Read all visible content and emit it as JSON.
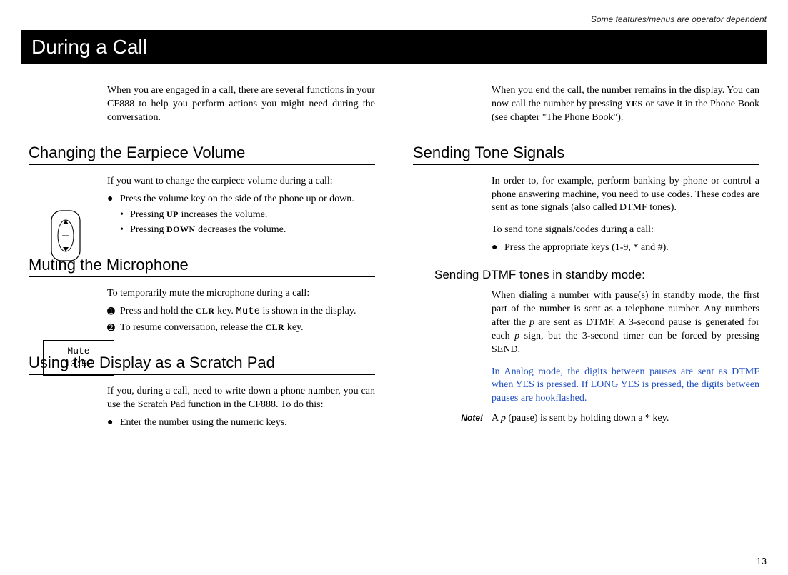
{
  "header_note": "Some features/menus are operator dependent",
  "page_title": "During a Call",
  "page_number": "13",
  "left": {
    "intro": "When you are engaged in a call, there are several functions in your CF888 to help you perform actions you might need during the conversation.",
    "s1": {
      "heading": "Changing the Earpiece Volume",
      "lead": "If you want to change the earpiece volume during a call:",
      "b1_pre": "Press the volume key on the side of the phone up or down.",
      "sb1_pre": "Pressing ",
      "sb1_key": "UP",
      "sb1_post": " increases the volume.",
      "sb2_pre": "Pressing ",
      "sb2_key": "DOWN",
      "sb2_post": " decreases the volume."
    },
    "s2": {
      "heading": "Muting the Microphone",
      "lead": "To temporarily mute the microphone during a call:",
      "b1_pre": "Press and hold the ",
      "b1_key": "CLR",
      "b1_mid": " key. ",
      "b1_mono": "Mute",
      "b1_post": " is shown in the display.",
      "b2_pre": "To resume conversation, release the ",
      "b2_key": "CLR",
      "b2_post": " key.",
      "display_line1": "Mute",
      "display_line2": "13:52"
    },
    "s3": {
      "heading": "Using the Display as a Scratch Pad",
      "lead": "If you, during a call, need to write down a phone number, you can use the Scratch Pad function in the CF888. To do this:",
      "b1": "Enter the number using the numeric keys."
    }
  },
  "right": {
    "intro_pre": "When you end the call, the number remains in the display. You can now call the number by pressing ",
    "intro_key": "YES",
    "intro_post": " or save it in the Phone Book (see chapter \"The Phone Book\").",
    "s4": {
      "heading": "Sending Tone Signals",
      "p1": "In order to, for example, perform banking by phone or control a phone answering machine, you need to use codes. These codes are sent as tone signals (also called DTMF tones).",
      "lead": "To send tone signals/codes during a call:",
      "b1": "Press the appropriate keys (1-9, * and #).",
      "sub_heading": "Sending DTMF tones in standby mode:",
      "p2_a": "When dialing a number with pause(s) in standby mode, the first part of the number is sent as a telephone number. Any numbers after the ",
      "p2_p1": "p",
      "p2_b": " are sent as DTMF. A 3-second pause is generated for each ",
      "p2_p2": "p",
      "p2_c": " sign, but the 3-second timer can be forced by pressing SEND.",
      "blue": "In Analog mode, the digits between pauses are sent as DTMF when YES is pressed. If LONG YES is pressed, the digits between pauses are hookflashed.",
      "note_label": "Note!",
      "note_a": "A ",
      "note_p": "p",
      "note_b": " (pause) is sent by holding down a * key."
    }
  }
}
